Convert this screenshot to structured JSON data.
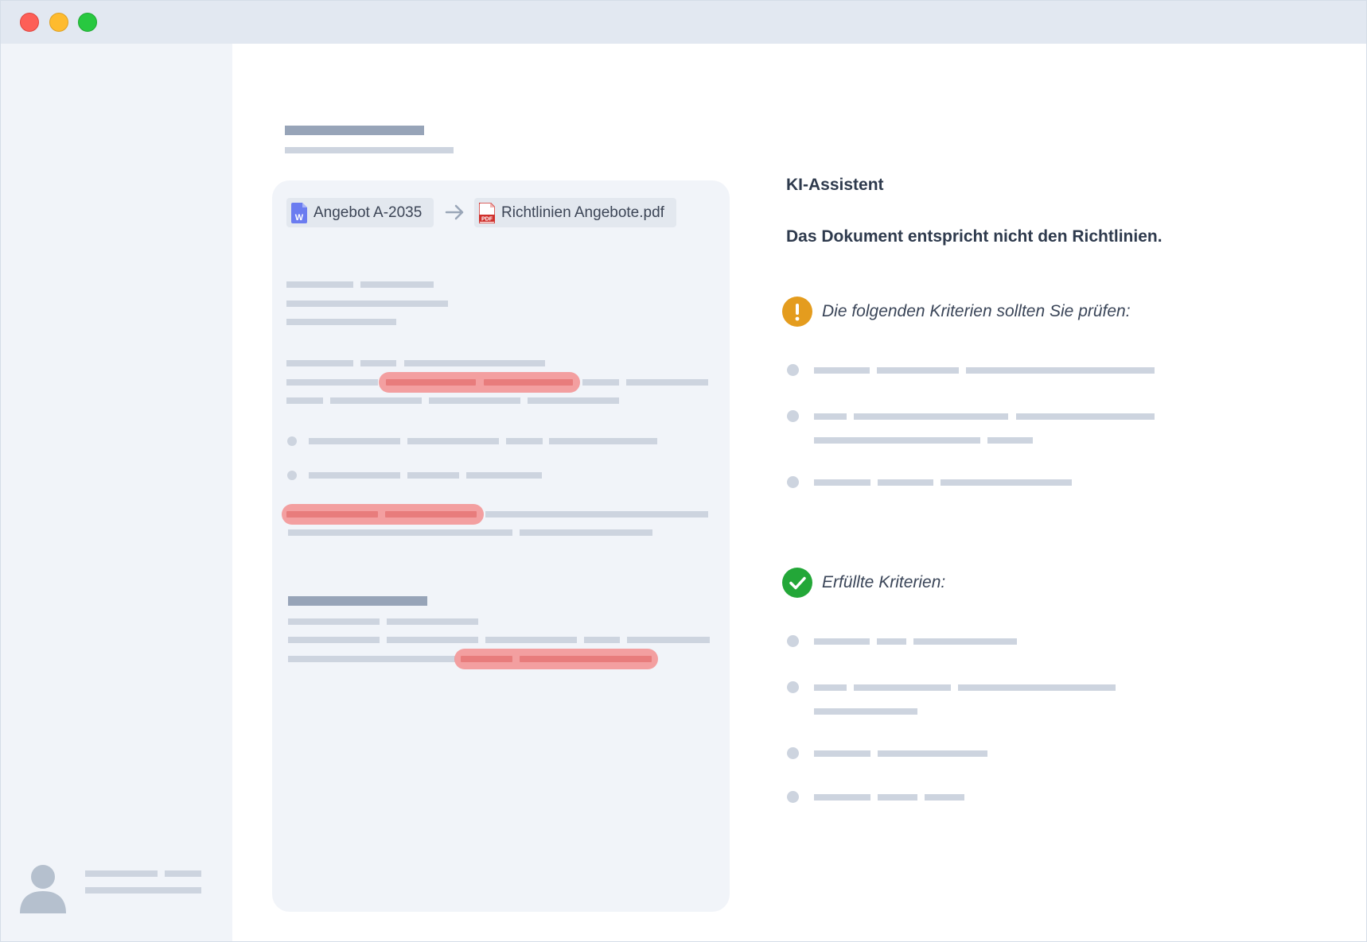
{
  "window": {
    "controls": {
      "close_color": "#fd5f57",
      "minimize_color": "#febb2e",
      "zoom_color": "#28c840"
    }
  },
  "sidebar": {
    "user": {
      "avatar_icon": "user-avatar-icon"
    }
  },
  "document": {
    "source_file": {
      "name": "Angebot A-2035",
      "icon": "word-document-icon",
      "icon_color": "#6b7cf0"
    },
    "arrow_icon": "arrow-right-icon",
    "reference_file": {
      "name": "Richtlinien Angebote.pdf",
      "icon": "pdf-document-icon",
      "icon_color": "#d0312d"
    },
    "highlight_color": "#f48686"
  },
  "assistant": {
    "title": "KI-Assistent",
    "result": "Das Dokument entspricht nicht den Richtlinien.",
    "sections": [
      {
        "label": "Die folgenden Kriterien sollten Sie prüfen:",
        "icon": "warning-icon",
        "color": "#e49c1e",
        "items": 3
      },
      {
        "label": "Erfüllte Kriterien:",
        "icon": "check-icon",
        "color": "#23a738",
        "items": 4
      }
    ]
  }
}
